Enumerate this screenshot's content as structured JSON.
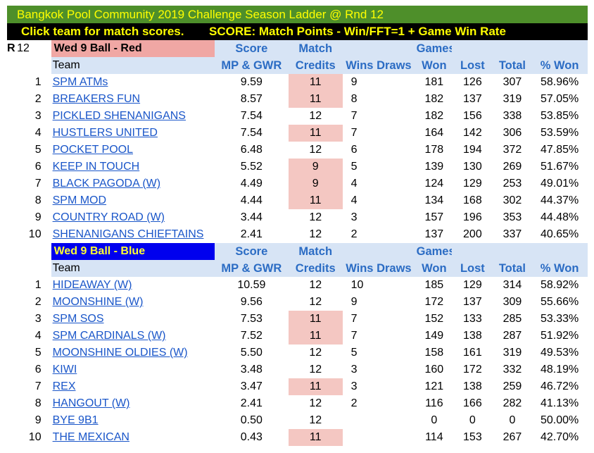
{
  "title": "Bangkok Pool Community 2019 Challenge Season Ladder @ Rnd 12",
  "subtitle_left": "Click team for match scores.",
  "subtitle_right": "SCORE: Match Points - Win/FFT=1 + Game Win Rate",
  "round_label": "R",
  "round_number": "12",
  "headers": {
    "team": "Team",
    "score": "Score",
    "score_sub": "MP & GWR",
    "match": "Match",
    "match_sub": "Credits",
    "wins": "Wins",
    "draws": "Draws",
    "games": "Games",
    "won": "Won",
    "lost": "Lost",
    "total": "Total",
    "pct": "% Won"
  },
  "divisions": [
    {
      "name": "Wed  9 Ball - Red",
      "rows": [
        {
          "rank": "1",
          "team": "SPM ATMs",
          "score": "9.59",
          "credits": "11",
          "wins": "9",
          "won": "181",
          "lost": "126",
          "total": "307",
          "pct": "58.96%"
        },
        {
          "rank": "2",
          "team": "BREAKERS FUN",
          "score": "8.57",
          "credits": "11",
          "wins": "8",
          "won": "182",
          "lost": "137",
          "total": "319",
          "pct": "57.05%"
        },
        {
          "rank": "3",
          "team": "PICKLED SHENANIGANS",
          "score": "7.54",
          "credits": "12",
          "wins": "7",
          "won": "182",
          "lost": "156",
          "total": "338",
          "pct": "53.85%"
        },
        {
          "rank": "4",
          "team": "HUSTLERS UNITED",
          "score": "7.54",
          "credits": "11",
          "wins": "7",
          "won": "164",
          "lost": "142",
          "total": "306",
          "pct": "53.59%"
        },
        {
          "rank": "5",
          "team": "POCKET POOL",
          "score": "6.48",
          "credits": "12",
          "wins": "6",
          "won": "178",
          "lost": "194",
          "total": "372",
          "pct": "47.85%"
        },
        {
          "rank": "6",
          "team": "KEEP IN TOUCH",
          "score": "5.52",
          "credits": "9",
          "wins": "5",
          "won": "139",
          "lost": "130",
          "total": "269",
          "pct": "51.67%"
        },
        {
          "rank": "7",
          "team": "BLACK PAGODA (W)",
          "score": "4.49",
          "credits": "9",
          "wins": "4",
          "won": "124",
          "lost": "129",
          "total": "253",
          "pct": "49.01%"
        },
        {
          "rank": "8",
          "team": "SPM MOD",
          "score": "4.44",
          "credits": "11",
          "wins": "4",
          "won": "134",
          "lost": "168",
          "total": "302",
          "pct": "44.37%"
        },
        {
          "rank": "9",
          "team": "COUNTRY ROAD (W)",
          "score": "3.44",
          "credits": "12",
          "wins": "3",
          "won": "157",
          "lost": "196",
          "total": "353",
          "pct": "44.48%"
        },
        {
          "rank": "10",
          "team": "SHENANIGANS CHIEFTAINS",
          "score": "2.41",
          "credits": "12",
          "wins": "2",
          "won": "137",
          "lost": "200",
          "total": "337",
          "pct": "40.65%"
        }
      ]
    },
    {
      "name": "Wed  9 Ball - Blue",
      "rows": [
        {
          "rank": "1",
          "team": "HIDEAWAY (W)",
          "score": "10.59",
          "credits": "12",
          "wins": "10",
          "won": "185",
          "lost": "129",
          "total": "314",
          "pct": "58.92%"
        },
        {
          "rank": "2",
          "team": "MOONSHINE (W)",
          "score": "9.56",
          "credits": "12",
          "wins": "9",
          "won": "172",
          "lost": "137",
          "total": "309",
          "pct": "55.66%"
        },
        {
          "rank": "3",
          "team": "SPM SOS",
          "score": "7.53",
          "credits": "11",
          "wins": "7",
          "won": "152",
          "lost": "133",
          "total": "285",
          "pct": "53.33%"
        },
        {
          "rank": "4",
          "team": "SPM CARDINALS (W)",
          "score": "7.52",
          "credits": "11",
          "wins": "7",
          "won": "149",
          "lost": "138",
          "total": "287",
          "pct": "51.92%"
        },
        {
          "rank": "5",
          "team": "MOONSHINE OLDIES (W)",
          "score": "5.50",
          "credits": "12",
          "wins": "5",
          "won": "158",
          "lost": "161",
          "total": "319",
          "pct": "49.53%"
        },
        {
          "rank": "6",
          "team": "KIWI",
          "score": "3.48",
          "credits": "12",
          "wins": "3",
          "won": "160",
          "lost": "172",
          "total": "332",
          "pct": "48.19%"
        },
        {
          "rank": "7",
          "team": "REX",
          "score": "3.47",
          "credits": "11",
          "wins": "3",
          "won": "121",
          "lost": "138",
          "total": "259",
          "pct": "46.72%"
        },
        {
          "rank": "8",
          "team": "HANGOUT (W)",
          "score": "2.41",
          "credits": "12",
          "wins": "2",
          "won": "116",
          "lost": "166",
          "total": "282",
          "pct": "41.13%"
        },
        {
          "rank": "9",
          "team": "BYE 9B1",
          "score": "0.50",
          "credits": "12",
          "wins": "",
          "won": "0",
          "lost": "0",
          "total": "0",
          "pct": "50.00%"
        },
        {
          "rank": "10",
          "team": "THE MEXICAN",
          "score": "0.43",
          "credits": "11",
          "wins": "",
          "won": "114",
          "lost": "153",
          "total": "267",
          "pct": "42.70%"
        }
      ]
    }
  ],
  "colors": {
    "title_bg": "#4e8f2a",
    "title_text": "#ffff00",
    "header_text": "#2b6cc4",
    "header_bg": "#d7e4f5",
    "red_division_bg": "#f0a7a4",
    "blue_division_bg": "#0000ee",
    "reduced_credit_bg": "#f4c7c2",
    "link": "#1a56c9"
  }
}
